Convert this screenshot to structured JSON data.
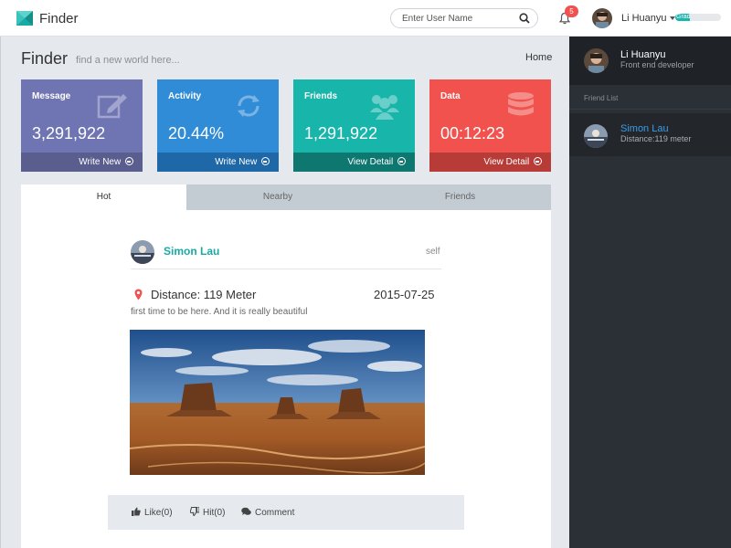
{
  "header": {
    "app_title": "Finder",
    "search": {
      "placeholder": "Enter User Name",
      "value": ""
    },
    "notifications": {
      "count": "5"
    },
    "user": {
      "name": "Li Huanyu",
      "grade_label": "Grade",
      "grade_fraction": 0.32
    }
  },
  "page": {
    "title": "Finder",
    "subtitle": "find a new world here...",
    "breadcrumb": "Home"
  },
  "cards": [
    {
      "label": "Message",
      "value": "3,291,922",
      "footer": "Write New",
      "icon": "edit-icon",
      "color": "#6f74b3",
      "footer_color": "#5a5e8e"
    },
    {
      "label": "Activity",
      "value": "20.44%",
      "footer": "Write New",
      "icon": "refresh-icon",
      "color": "#318cd8",
      "footer_color": "#1f68a8"
    },
    {
      "label": "Friends",
      "value": "1,291,922",
      "footer": "View Detail",
      "icon": "users-icon",
      "color": "#18b5ab",
      "footer_color": "#0e7770"
    },
    {
      "label": "Data",
      "value": "00:12:23",
      "footer": "View Detail",
      "icon": "database-icon",
      "color": "#f1524d",
      "footer_color": "#b73b37"
    }
  ],
  "tabs": [
    {
      "label": "Hot",
      "active": true
    },
    {
      "label": "Nearby",
      "active": false
    },
    {
      "label": "Friends",
      "active": false
    }
  ],
  "post": {
    "author": "Simon Lau",
    "tag": "self",
    "distance": "Distance: 119 Meter",
    "date": "2015-07-25",
    "text": "first time to be here. And it is really beautiful",
    "photo_icon": "desert-landscape-photo",
    "actions": {
      "like": "Like(0)",
      "hit": "Hit(0)",
      "comment": "Comment"
    }
  },
  "sidebar": {
    "user_name": "Li Huanyu",
    "user_role": "Front end developer",
    "section_title": "Friend List",
    "friends": [
      {
        "name": "Simon Lau",
        "distance": "Distance:119 meter"
      }
    ]
  }
}
